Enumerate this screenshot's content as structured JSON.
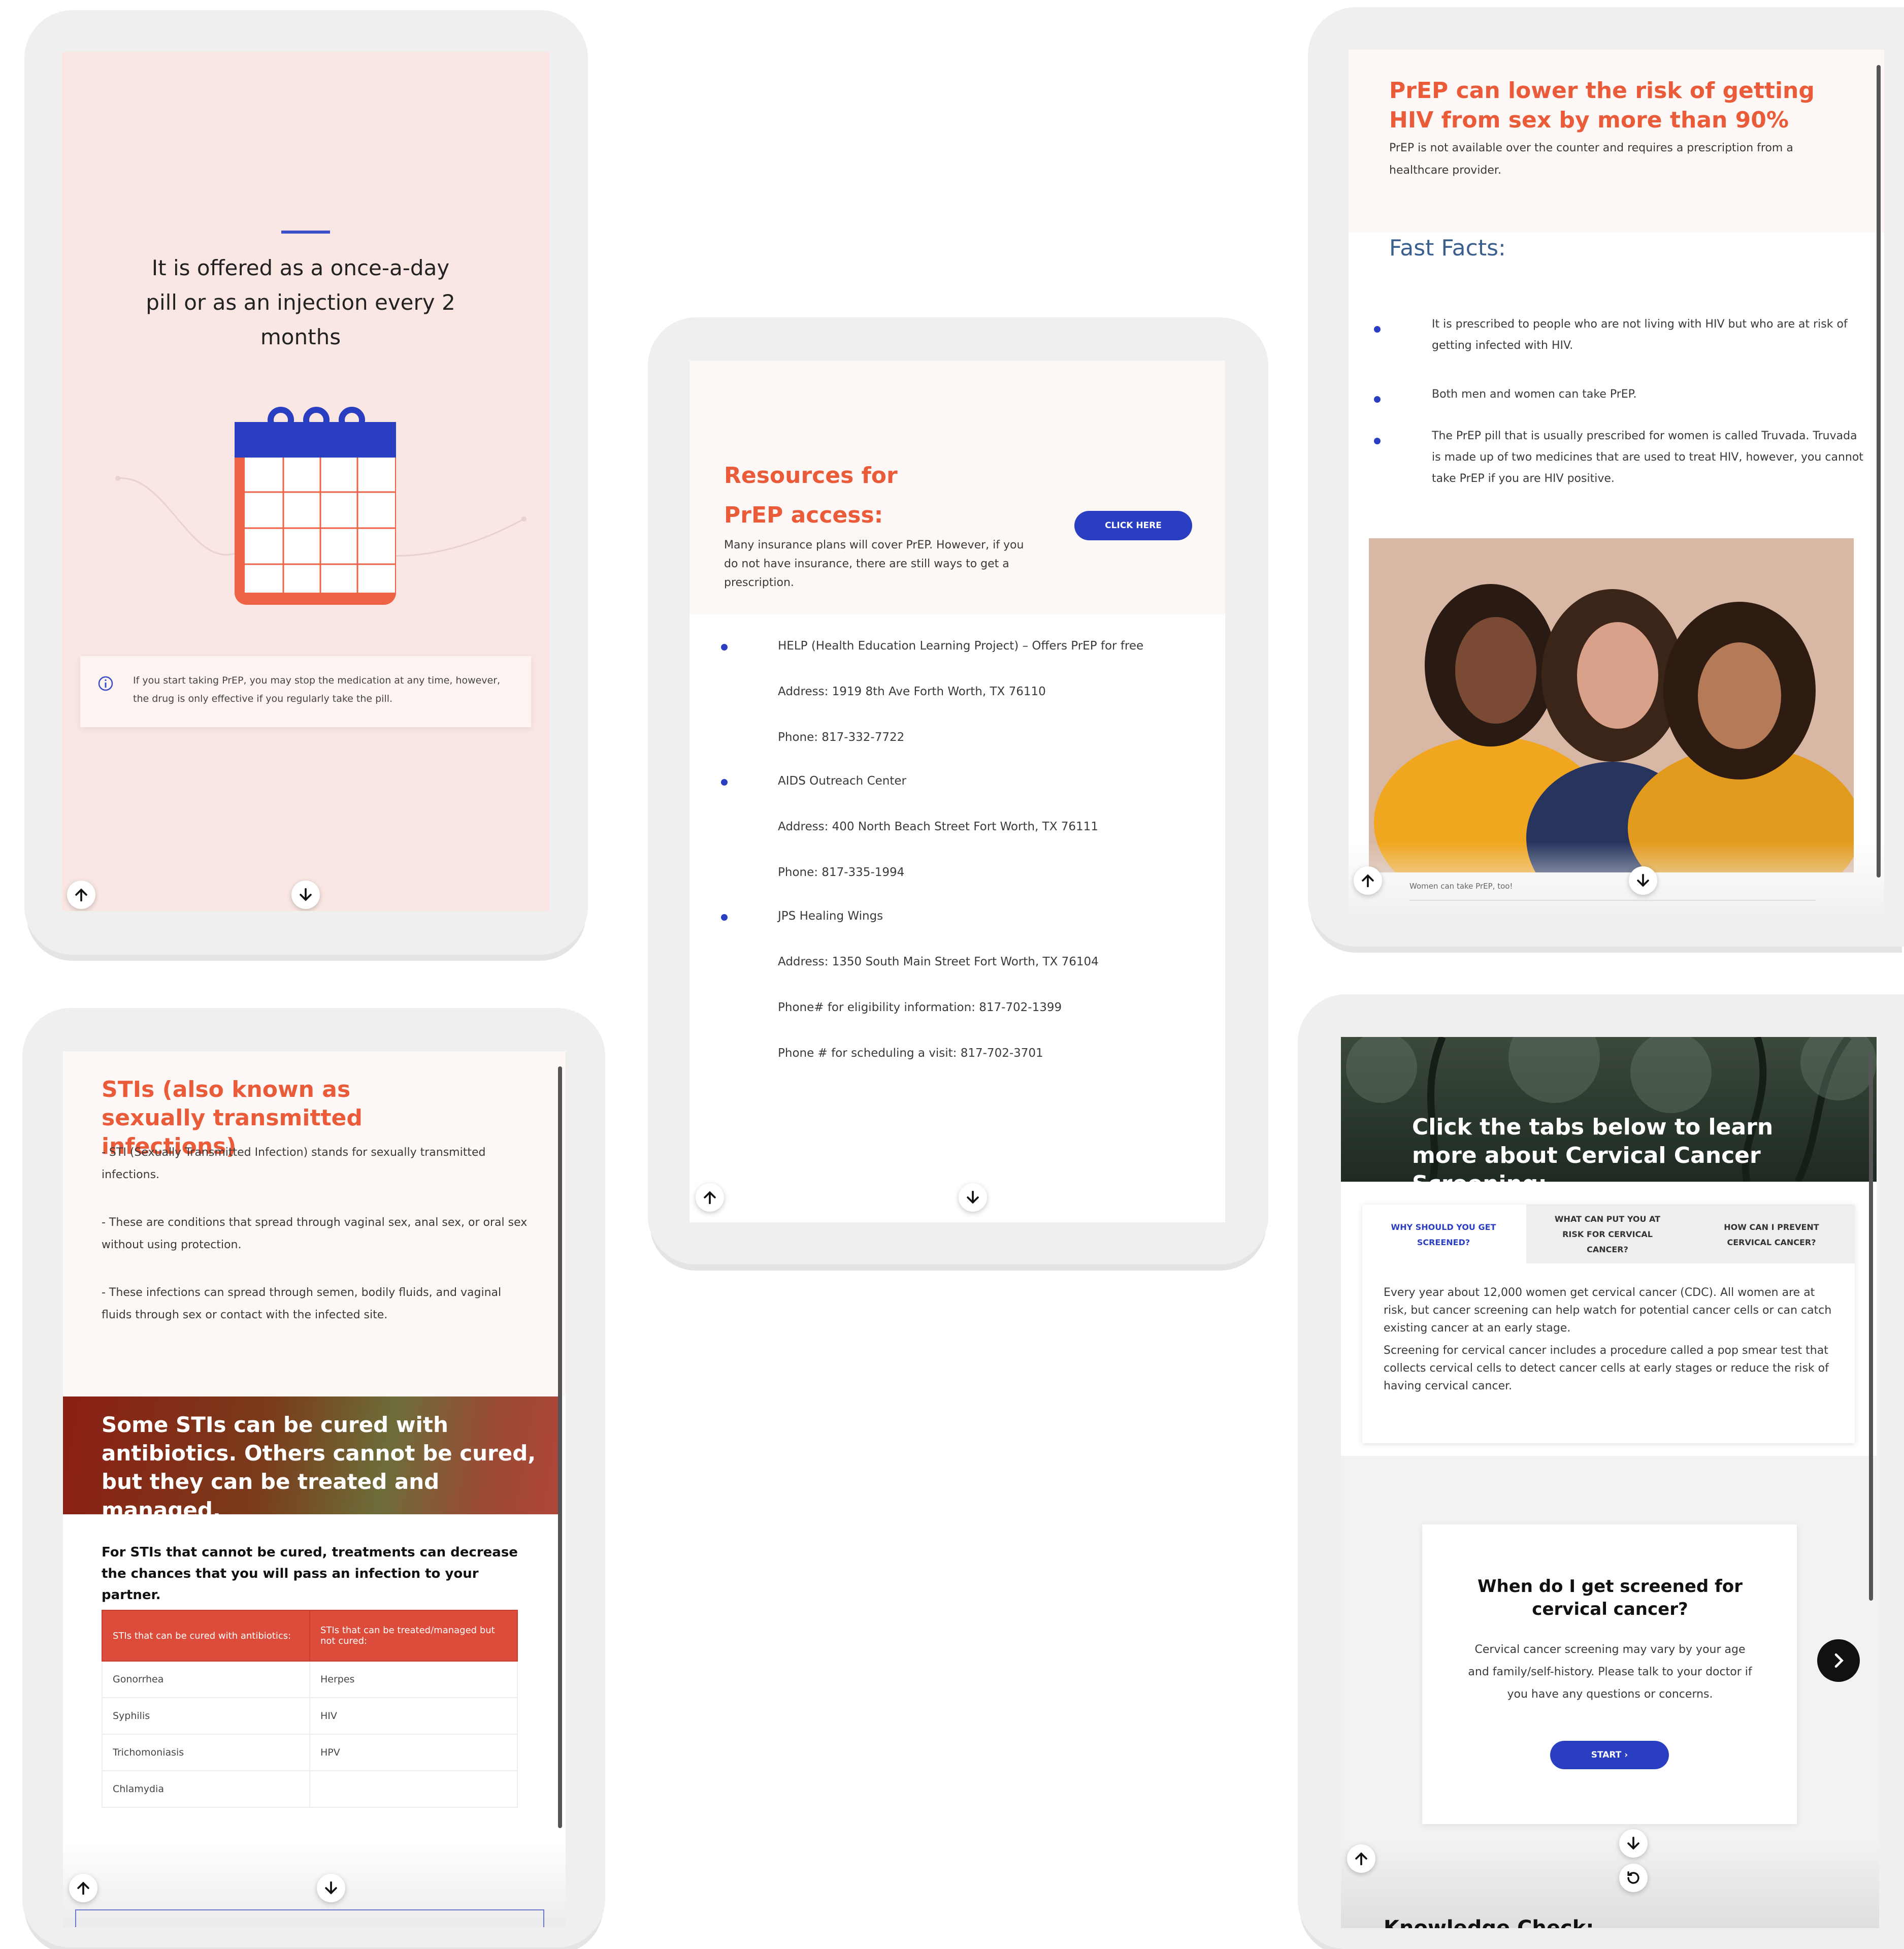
{
  "panel1": {
    "title": "It is offered as a once-a-day pill or as an injection every 2 months",
    "info_text": "If you start taking PrEP, you may stop the medication at any time, however, the drug is only effective if you regularly take the pill."
  },
  "panel2": {
    "title": "Resources for PrEP access:",
    "description": "Many insurance plans will cover PrEP. However, if you do not have insurance, there are still ways to get a prescription.",
    "button": "CLICK HERE",
    "resources": [
      {
        "name": "HELP (Health Education Learning Project) – Offers PrEP for free",
        "lines": [
          "Address: 1919 8th Ave Forth Worth, TX 76110",
          "Phone:  817-332-7722"
        ]
      },
      {
        "name": "AIDS Outreach Center",
        "lines": [
          "Address: 400 North Beach Street Fort Worth, TX 76111",
          "Phone: 817-335-1994"
        ]
      },
      {
        "name": "JPS Healing Wings",
        "lines": [
          "Address: 1350 South Main Street Fort Worth, TX 76104",
          "Phone# for eligibility information: 817-702-1399",
          "Phone # for scheduling a visit: 817-702-3701"
        ]
      }
    ]
  },
  "panel3": {
    "title": "PrEP can lower the risk of getting HIV from sex by more than 90%",
    "subtitle": "PrEP is not available over the counter and requires a prescription from a healthcare provider.",
    "facts_heading": "Fast Facts:",
    "facts": [
      "It is prescribed to people who are not living with HIV but who are at risk of getting infected with HIV.",
      "Both men and women can take PrEP.",
      "The PrEP pill that is usually prescribed for women is called Truvada. Truvada is made up of two medicines that are used to treat HIV, however, you cannot take PrEP if you are HIV positive."
    ],
    "caption": "Women can take PrEP, too!"
  },
  "panel4": {
    "title": "STIs (also known as sexually transmitted infections)",
    "paragraphs": [
      "- STI (Sexually Transmitted Infection) stands for sexually transmitted infections.",
      "-  These are conditions that spread through vaginal sex, anal sex, or oral sex without using protection.",
      "- These infections can spread through semen, bodily fluids, and vaginal fluids through sex or contact with the infected site."
    ],
    "banner": "Some STIs can be cured with antibiotics. Others cannot be cured, but they can be treated and managed.",
    "note": "For STIs that cannot be cured, treatments can decrease the chances that you will pass an infection to your partner.",
    "table": {
      "headers": [
        "STIs that can be cured with antibiotics:",
        "STIs that can be treated/managed but not cured:"
      ],
      "rows": [
        [
          "Gonorrhea",
          "Herpes"
        ],
        [
          "Syphilis",
          "HIV"
        ],
        [
          "Trichomoniasis",
          "HPV"
        ],
        [
          "Chlamydia",
          ""
        ]
      ]
    }
  },
  "panel5": {
    "hero": "Click the tabs below to learn more about Cervical Cancer Screening:",
    "tabs": [
      "WHY SHOULD YOU GET SCREENED?",
      "WHAT CAN PUT YOU AT RISK FOR CERVICAL CANCER?",
      "HOW CAN I PREVENT CERVICAL CANCER?"
    ],
    "tab_paragraphs": [
      "Every year about 12,000 women get cervical cancer (CDC). All women are at risk, but cancer screening can help watch for potential cancer cells or can catch existing cancer at an early stage.",
      "Screening for cervical cancer includes a procedure called a pop smear test that collects cervical cells to detect cancer cells at early stages or reduce the risk of having cervical cancer."
    ],
    "card_title": "When do I get screened for cervical cancer?",
    "card_text": "Cervical cancer screening may vary by your age and family/self-history. Please talk to your doctor if you have any questions or concerns.",
    "start_button": "START",
    "bottom_heading": "Knowledge Check:"
  },
  "colors": {
    "accent_blue": "#2a3ec2",
    "accent_orange": "#ea5b3a",
    "table_red": "#dd4c3b"
  }
}
